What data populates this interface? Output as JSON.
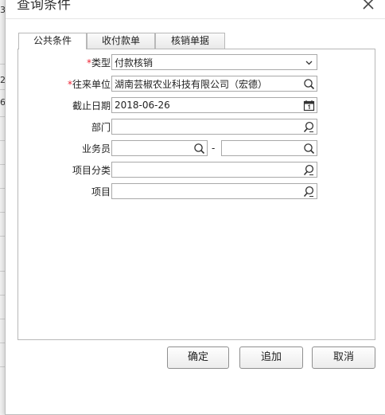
{
  "dialog": {
    "title": "查询条件"
  },
  "tabs": [
    {
      "label": "公共条件",
      "active": true
    },
    {
      "label": "收付款单",
      "active": false
    },
    {
      "label": "核销单据",
      "active": false
    }
  ],
  "form": {
    "type": {
      "label": "类型",
      "required": true,
      "value": "付款核销"
    },
    "unit": {
      "label": "往来单位",
      "required": true,
      "value": "湖南芸椒农业科技有限公司（宏德）"
    },
    "deadline": {
      "label": "截止日期",
      "value": "2018-06-26"
    },
    "department": {
      "label": "部门",
      "value": ""
    },
    "salesperson": {
      "label": "业务员",
      "value_from": "",
      "value_to": "",
      "separator": "-"
    },
    "project_category": {
      "label": "项目分类",
      "value": ""
    },
    "project": {
      "label": "项目",
      "value": ""
    }
  },
  "buttons": {
    "ok": "确定",
    "append": "追加",
    "cancel": "取消"
  },
  "background": {
    "fragments": [
      "3",
      "2",
      "6("
    ]
  }
}
